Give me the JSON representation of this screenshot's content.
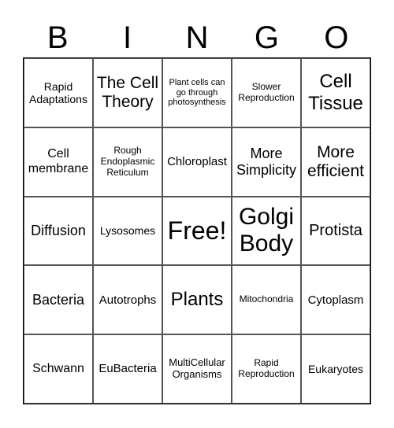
{
  "header": [
    "B",
    "I",
    "N",
    "G",
    "O"
  ],
  "cells": [
    "Rapid Adaptations",
    "The Cell Theory",
    "Plant cells can go through photosynthesis",
    "Slower Reproduction",
    "Cell Tissue",
    "Cell membrane",
    "Rough Endoplasmic Reticulum",
    "Chloroplast",
    "More Simplicity",
    "More efficient",
    "Diffusion",
    "Lysosomes",
    "Free!",
    "Golgi Body",
    "Protista",
    "Bacteria",
    "Autotrophs",
    "Plants",
    "Mitochondria",
    "Cytoplasm",
    "Schwann",
    "EuBacteria",
    "MultiCellular Organisms",
    "Rapid Reproduction",
    "Eukaryotes"
  ]
}
